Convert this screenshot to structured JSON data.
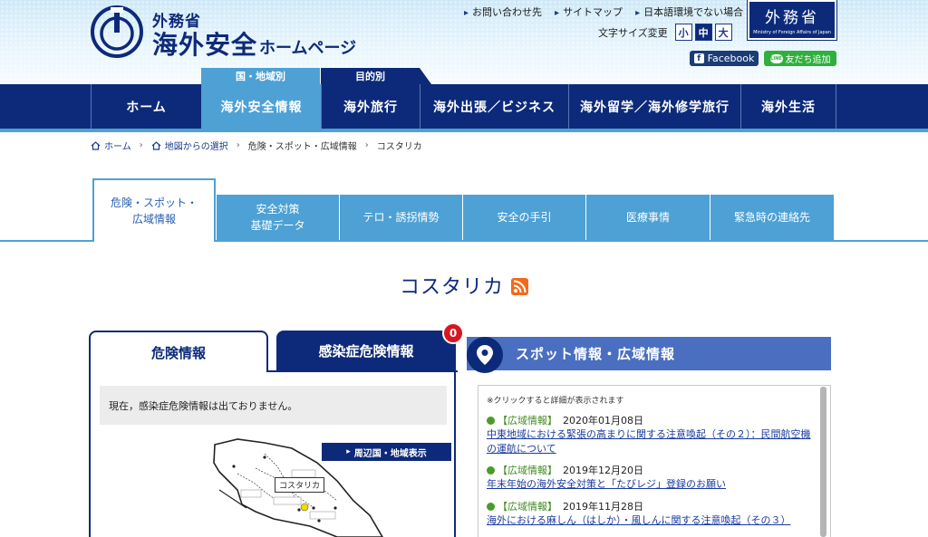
{
  "header": {
    "logo_small": "外務省",
    "logo_big": "海外安全",
    "logo_big_suffix": "ホームページ",
    "top_links": [
      "お問い合わせ先",
      "サイトマップ",
      "日本語環境でない場合"
    ],
    "font_size_label": "文字サイズ変更",
    "font_sizes": [
      "小",
      "中",
      "大"
    ],
    "font_size_selected": "中",
    "mofa_logo": "外務省",
    "mofa_logo_sub": "Ministry of Foreign Affairs of Japan",
    "facebook": "Facebook",
    "line": "友だち追加",
    "line_icon_text": "LINE",
    "category_tabs": [
      "国・地域別",
      "目的別"
    ]
  },
  "nav": {
    "items": [
      "ホーム",
      "海外安全情報",
      "海外旅行",
      "海外出張／ビジネス",
      "海外留学／海外修学旅行",
      "海外生活"
    ],
    "active": "海外安全情報"
  },
  "breadcrumb": [
    "ホーム",
    "地図からの選択",
    "危険・スポット・広域情報",
    "コスタリカ"
  ],
  "subtabs": [
    "危険・スポット・\n広域情報",
    "安全対策\n基礎データ",
    "テロ・誘拐情勢",
    "安全の手引",
    "医療事情",
    "緊急時の連絡先"
  ],
  "page_title": "コスタリカ",
  "left": {
    "tab_danger": "危険情報",
    "tab_infection": "感染症危険情報",
    "infection_count": "0",
    "notice": "現在，感染症危険情報は出ておりません。",
    "map_label": "周辺国・地域表示",
    "map_country": "コスタリカ"
  },
  "right": {
    "title": "スポット情報・広域情報",
    "note": "※クリックすると詳細が表示されます",
    "items": [
      {
        "category": "【広域情報】",
        "date": "2020年01月08日",
        "title": "中東地域における緊張の高まりに関する注意喚起（その２）：民間航空機の運航について"
      },
      {
        "category": "【広域情報】",
        "date": "2019年12月20日",
        "title": "年末年始の海外安全対策と「たびレジ」登録のお願い"
      },
      {
        "category": "【広域情報】",
        "date": "2019年11月28日",
        "title": "海外における麻しん（はしか）・風しんに関する注意喚起（その３）"
      }
    ]
  },
  "colors": {
    "navy": "#0d2a7a",
    "light_blue": "#4da1d4",
    "spot_blue": "#4a6fc1",
    "green": "#4a9b2a",
    "badge_red": "#d8161f",
    "rss_orange": "#f26a1b"
  }
}
